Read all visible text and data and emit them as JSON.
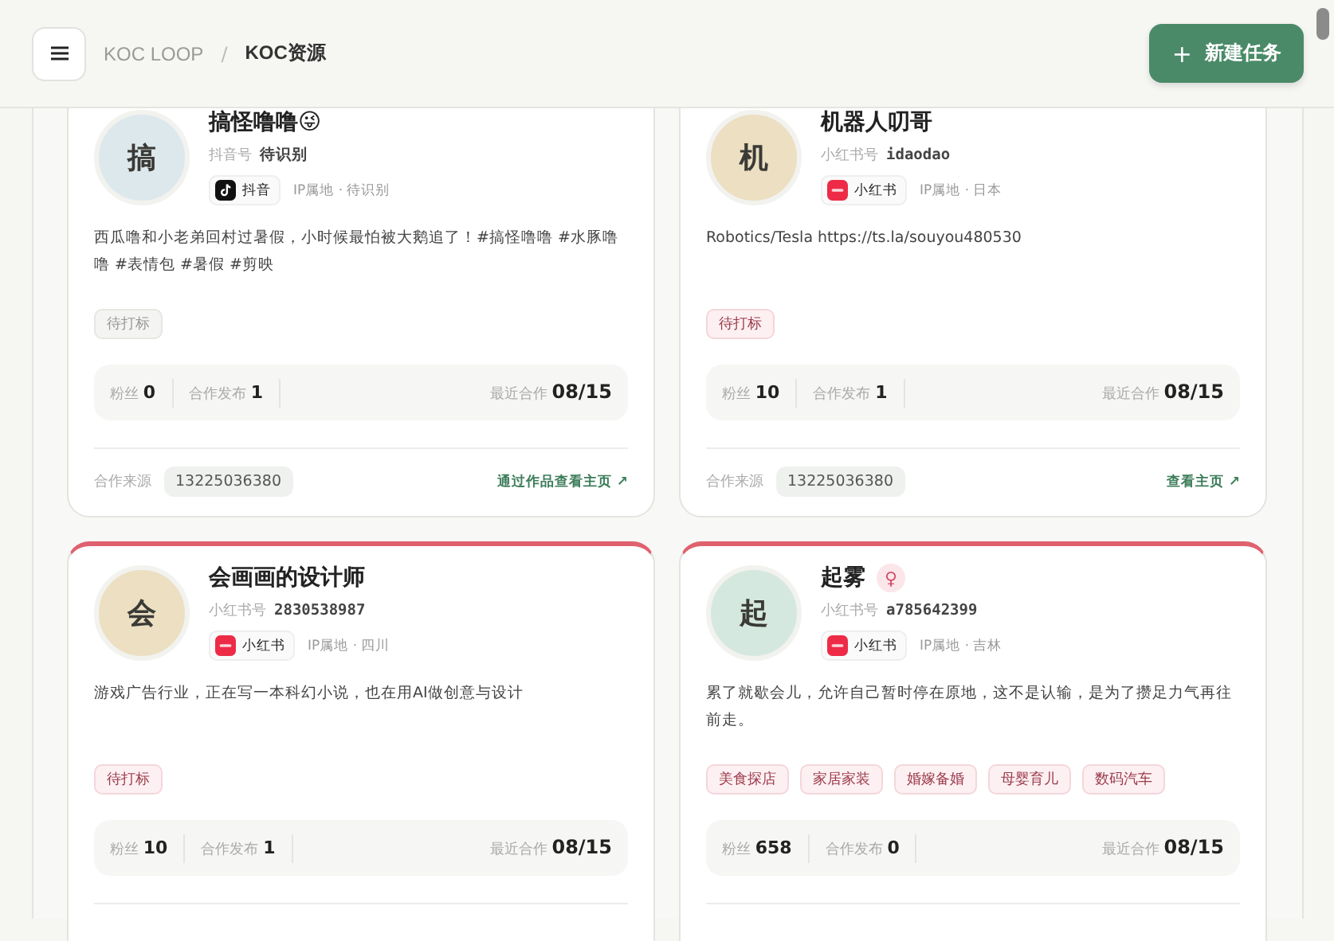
{
  "header": {
    "breadcrumb": [
      {
        "label": "KOC LOOP",
        "selected": false
      },
      {
        "label": "KOC资源",
        "selected": true
      }
    ],
    "separator": "/",
    "action_button": {
      "icon": "+",
      "label": "新建任务"
    }
  },
  "cards": [
    {
      "avatar": {
        "char": "搞",
        "color": "#dde8ec"
      },
      "name": "搞怪噜噜😜",
      "handle_label": "抖音号",
      "handle": "待识别",
      "platform": {
        "kind": "douyin",
        "label": "抖音"
      },
      "ip": "IP属地 · 待识别",
      "bio": "西瓜噜和小老弟回村过暑假，小时候最怕被大鹅追了！#搞怪噜噜 #水豚噜噜 #表情包 #暑假 #剪映",
      "tags": [
        {
          "label": "待打标",
          "kind": "neutral"
        }
      ],
      "stats": {
        "fans_label": "粉丝",
        "fans": "0",
        "posts_label": "合作发布",
        "posts": "1",
        "recent_label": "最近合作",
        "recent": "08/15"
      },
      "footer": {
        "source_label": "合作来源",
        "source": "13225036380",
        "link": "通过作品查看主页 ↗"
      }
    },
    {
      "avatar": {
        "char": "机",
        "color": "#ecdfc2"
      },
      "name": "机器人叨哥",
      "handle_label": "小红书号",
      "handle": "idaodao",
      "platform": {
        "kind": "xhs",
        "label": "小红书"
      },
      "ip": "IP属地 · 日本",
      "bio": "Robotics/Tesla https://ts.la/souyou480530",
      "tags": [
        {
          "label": "待打标",
          "kind": "accent"
        }
      ],
      "stats": {
        "fans_label": "粉丝",
        "fans": "10",
        "posts_label": "合作发布",
        "posts": "1",
        "recent_label": "最近合作",
        "recent": "08/15"
      },
      "footer": {
        "source_label": "合作来源",
        "source": "13225036380",
        "link": "查看主页 ↗"
      }
    },
    {
      "avatar": {
        "char": "会",
        "color": "#ecdfc2"
      },
      "name": "会画画的设计师",
      "handle_label": "小红书号",
      "handle": "2830538987",
      "platform": {
        "kind": "xhs",
        "label": "小红书"
      },
      "ip": "IP属地 · 四川",
      "bio": "游戏广告行业，正在写一本科幻小说，也在用AI做创意与设计",
      "tags": [
        {
          "label": "待打标",
          "kind": "accent"
        }
      ],
      "stats": {
        "fans_label": "粉丝",
        "fans": "10",
        "posts_label": "合作发布",
        "posts": "1",
        "recent_label": "最近合作",
        "recent": "08/15"
      },
      "flagged": true
    },
    {
      "avatar": {
        "char": "起",
        "color": "#d5e8df"
      },
      "name": "起雾",
      "gender": "♀",
      "handle_label": "小红书号",
      "handle": "a785642399",
      "platform": {
        "kind": "xhs",
        "label": "小红书"
      },
      "ip": "IP属地 · 吉林",
      "bio": "累了就歇会儿，允许自己暂时停在原地，这不是认输，是为了攒足力气再往前走。",
      "tags": [
        {
          "label": "美食探店",
          "kind": "accent"
        },
        {
          "label": "家居家装",
          "kind": "accent"
        },
        {
          "label": "婚嫁备婚",
          "kind": "accent"
        },
        {
          "label": "母婴育儿",
          "kind": "accent"
        },
        {
          "label": "数码汽车",
          "kind": "accent"
        }
      ],
      "stats": {
        "fans_label": "粉丝",
        "fans": "658",
        "posts_label": "合作发布",
        "posts": "0",
        "recent_label": "最近合作",
        "recent": "08/15"
      },
      "flagged": true
    }
  ]
}
